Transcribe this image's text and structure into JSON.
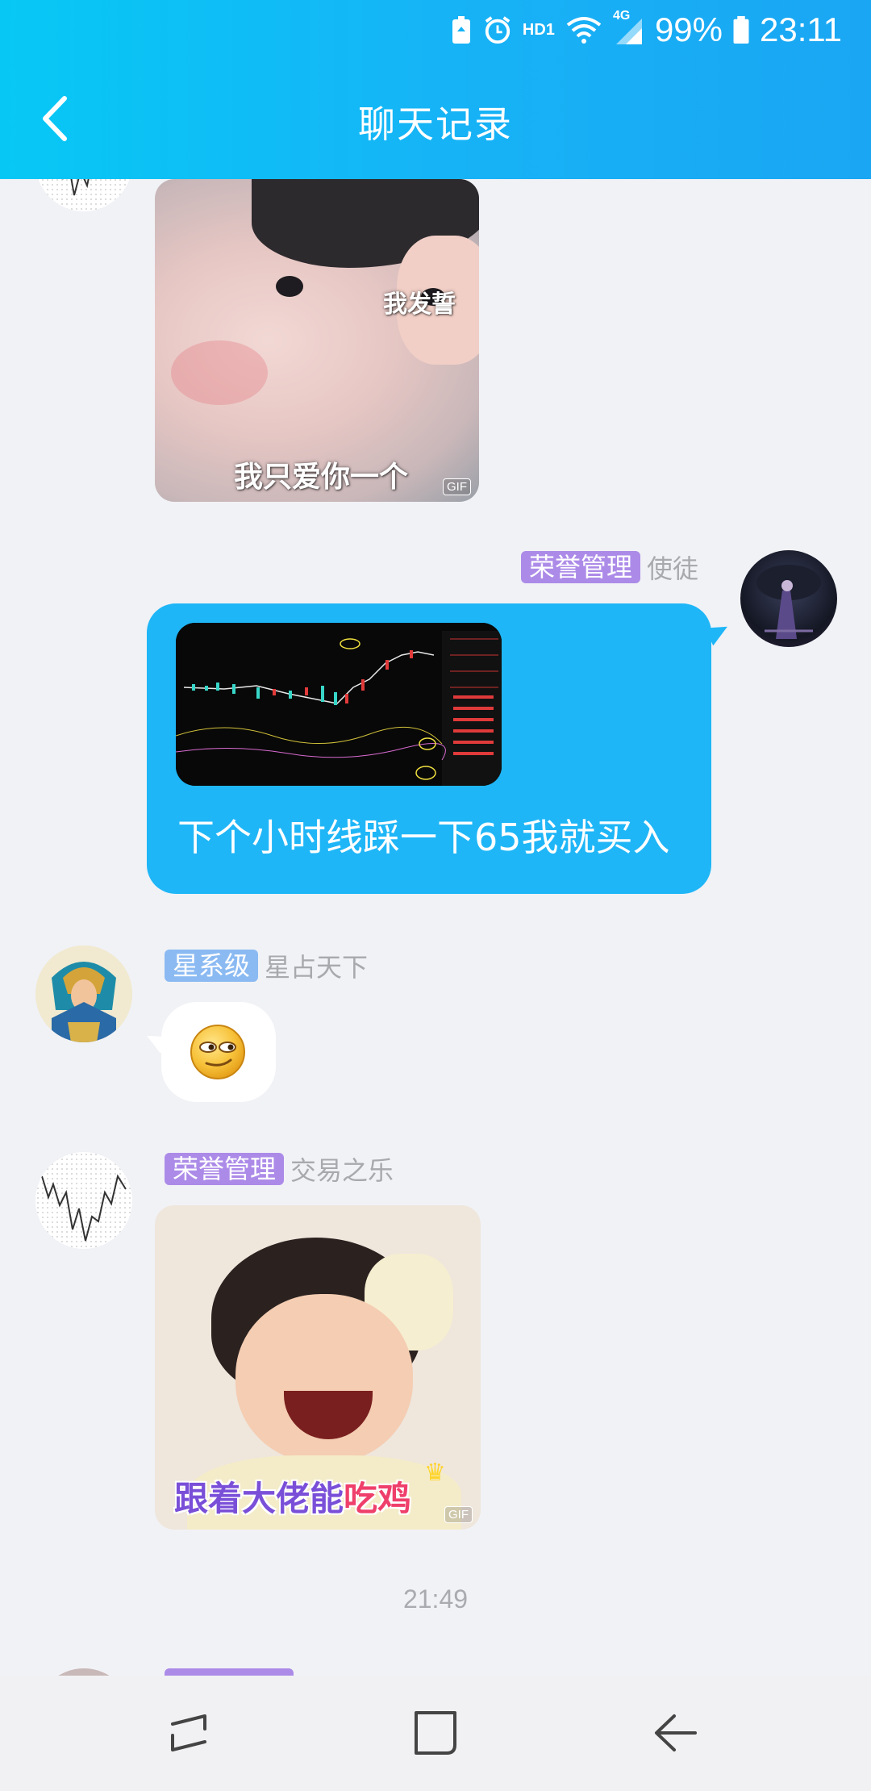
{
  "status_bar": {
    "network_label": "HD1",
    "signal_label": "4G",
    "battery": "99%",
    "time": "23:11"
  },
  "header": {
    "title": "聊天记录"
  },
  "messages": [
    {
      "id": "m1",
      "side": "left",
      "type": "image",
      "image_captions": [
        "我发誓",
        "我只爱你一个"
      ],
      "gif_tag": "GIF"
    },
    {
      "id": "m2",
      "side": "right",
      "badge": "荣誉管理",
      "nickname": "使徒",
      "type": "image+text",
      "text": "下个小时线踩一下65我就买入"
    },
    {
      "id": "m3",
      "side": "left",
      "badge": "星系级",
      "nickname": "星占天下",
      "type": "emoji",
      "emoji": "smirk-emoji"
    },
    {
      "id": "m4",
      "side": "left",
      "badge": "荣誉管理",
      "nickname": "交易之乐",
      "type": "image",
      "image_caption_parts": [
        "跟着大佬能",
        "吃鸡"
      ],
      "gif_tag": "GIF"
    }
  ],
  "timestamp": "21:49",
  "colors": {
    "header_start": "#07c8f5",
    "header_end": "#1aa6f3",
    "bubble_self": "#1fb6f7",
    "badge_honor": "#ac8be8",
    "badge_galaxy": "#8bbaf2",
    "background": "#f1f2f6"
  },
  "nav_bar": {
    "recents": "recent-apps-icon",
    "home": "home-icon",
    "back": "back-icon"
  }
}
